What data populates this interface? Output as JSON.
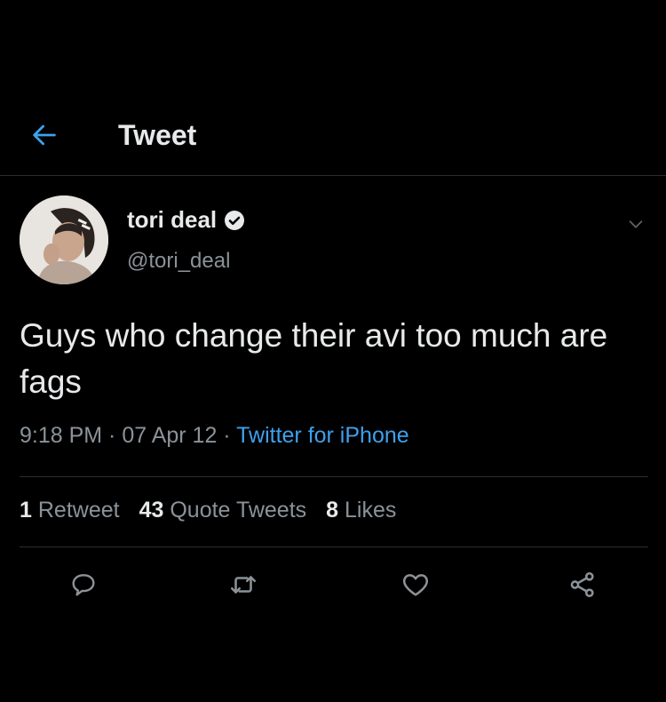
{
  "header": {
    "back_icon": "arrow-left-icon",
    "title": "Tweet"
  },
  "author": {
    "display_name": "tori deal",
    "verified_icon": "verified-badge-icon",
    "handle": "@tori_deal",
    "more_icon": "chevron-down-icon"
  },
  "tweet": {
    "text": "Guys who change their avi too much are fags",
    "time": "9:18 PM",
    "separator": " · ",
    "date": "07 Apr 12",
    "source": "Twitter for iPhone"
  },
  "stats": {
    "retweets_count": "1",
    "retweets_label": "Retweet",
    "quotes_count": "43",
    "quotes_label": "Quote Tweets",
    "likes_count": "8",
    "likes_label": "Likes"
  },
  "actions": {
    "reply_icon": "reply-icon",
    "retweet_icon": "retweet-icon",
    "like_icon": "heart-icon",
    "share_icon": "share-icon"
  },
  "colors": {
    "background": "#000000",
    "text": "#e7e9ea",
    "secondary": "#8b9298",
    "accent": "#3ea1ec",
    "divider": "#2a2d30"
  }
}
